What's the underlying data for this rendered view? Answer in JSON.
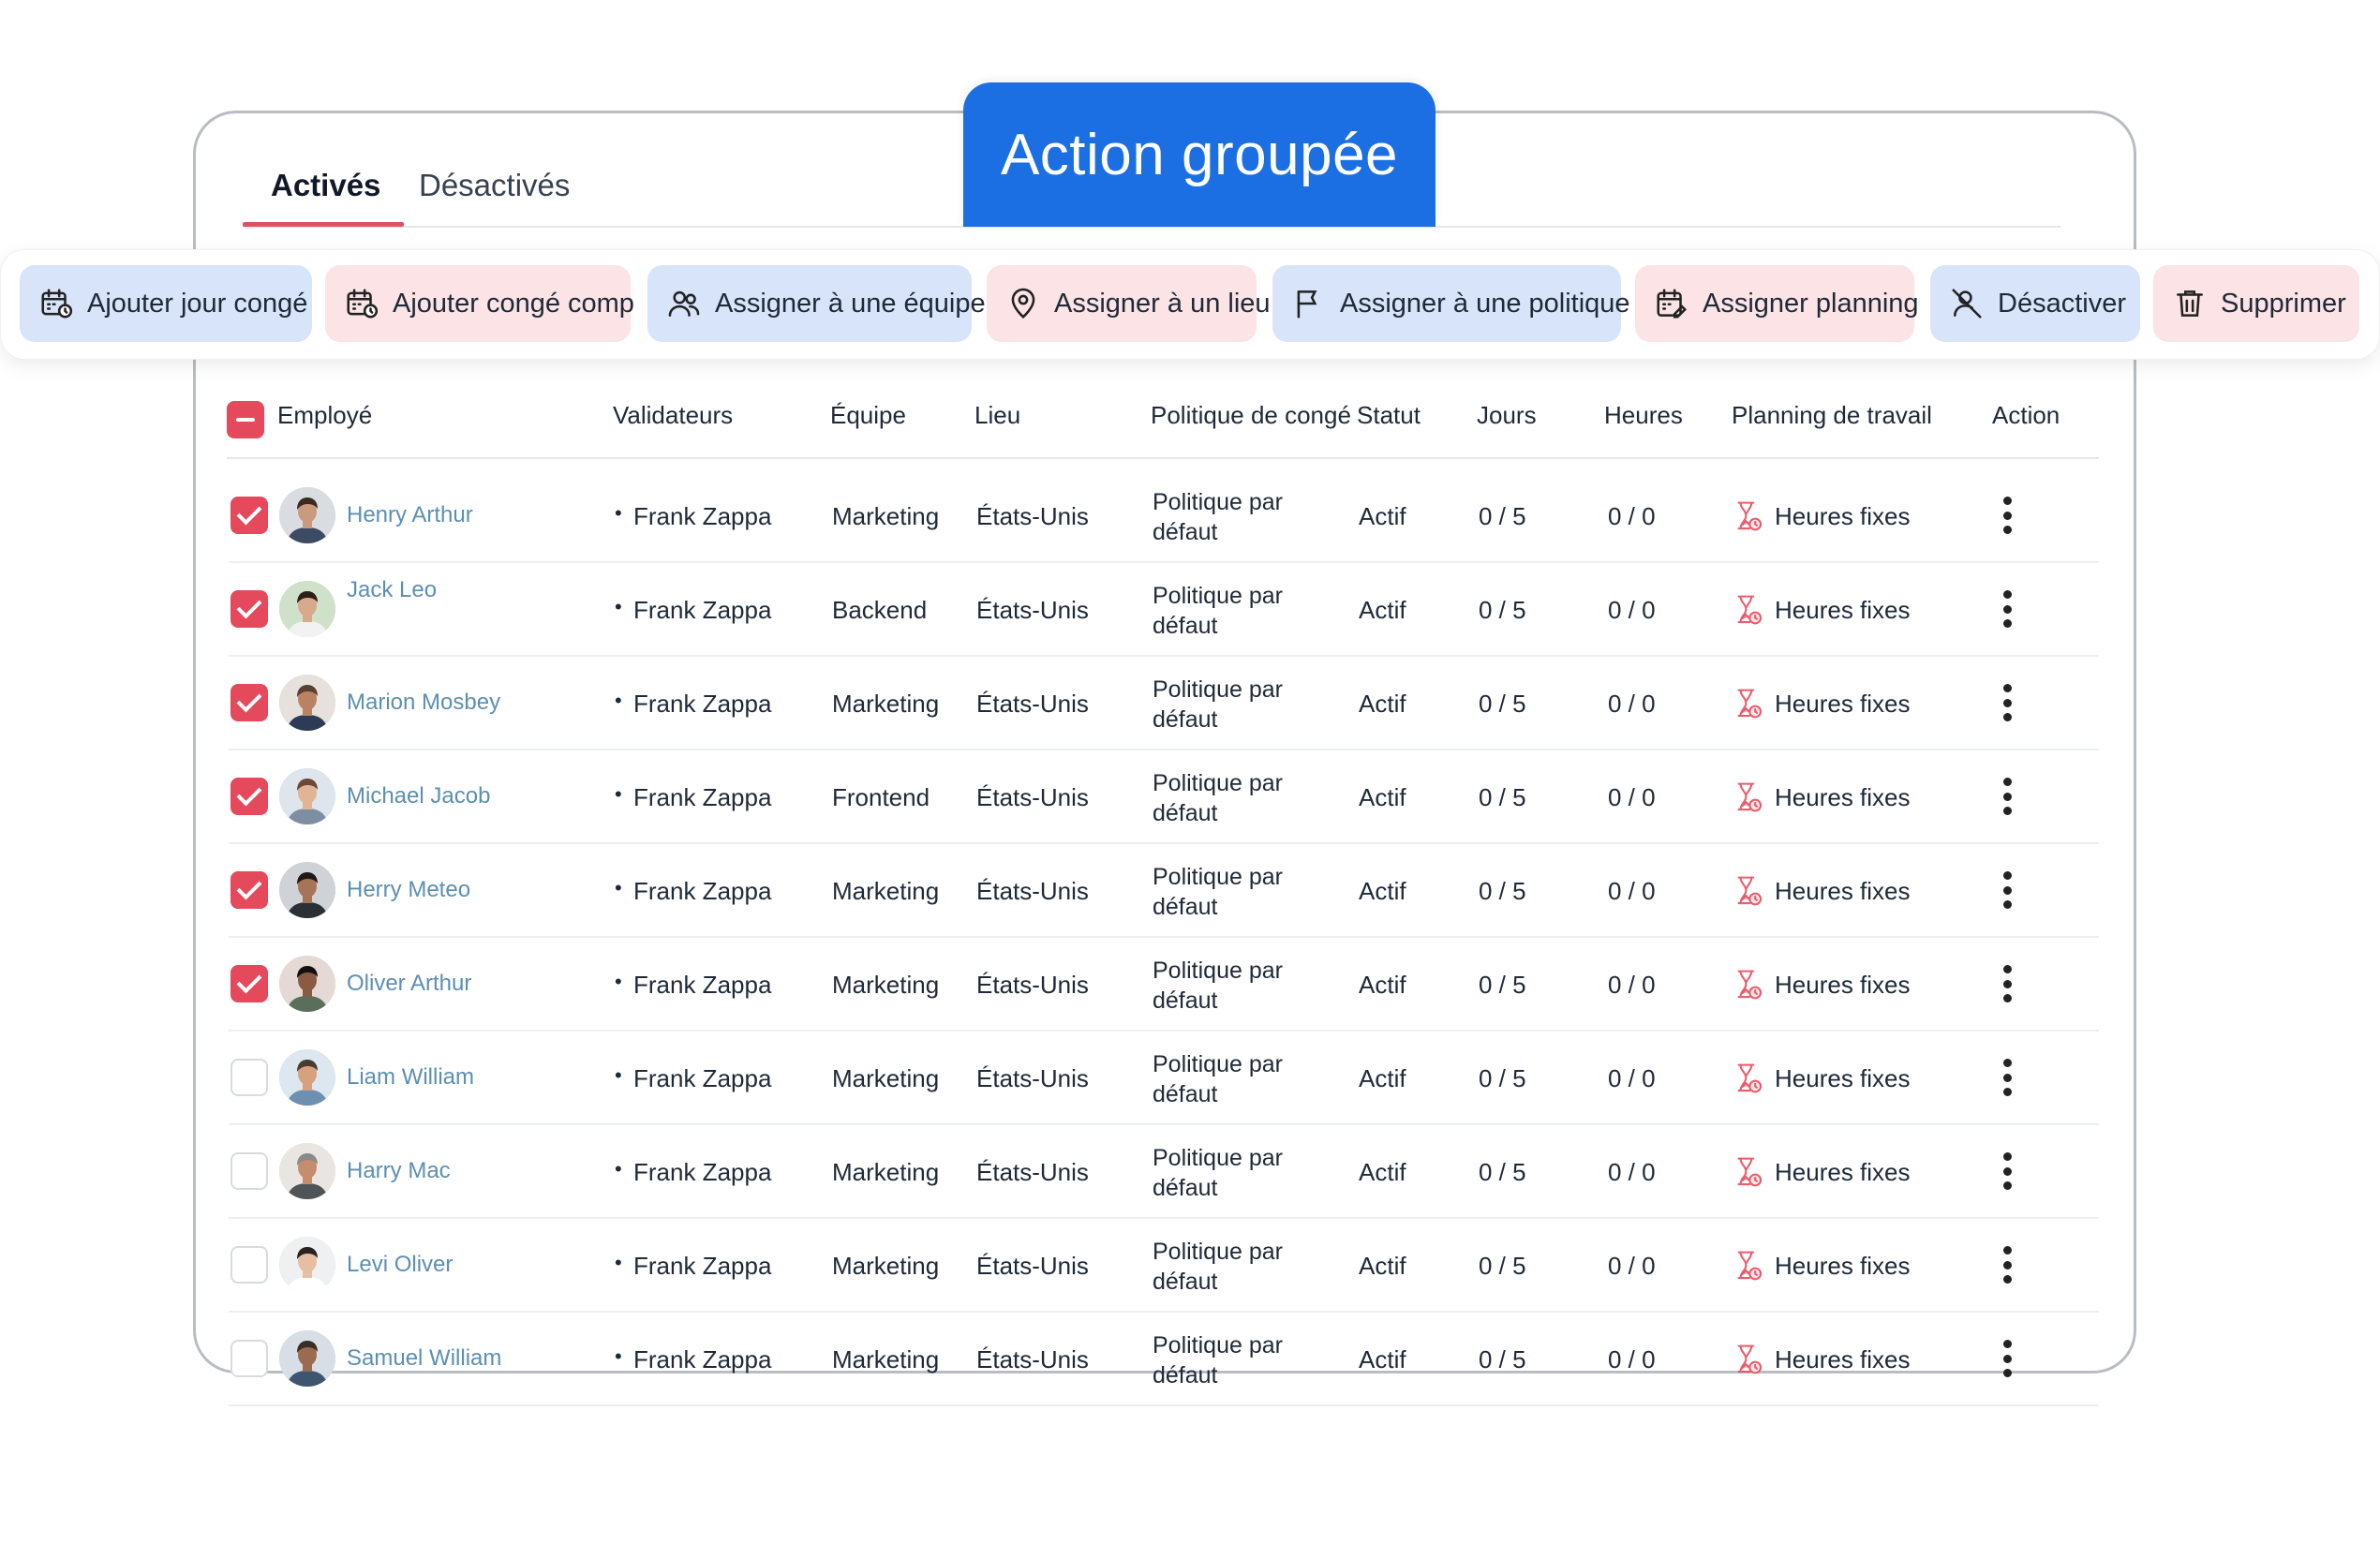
{
  "badge": {
    "title": "Action groupée",
    "color": "#1b6fe3"
  },
  "tabs": {
    "active": "Activés",
    "inactive": "Désactivés"
  },
  "toolbar": [
    {
      "label": "Ajouter jour congé",
      "icon": "calendar-clock-icon",
      "style": "blue"
    },
    {
      "label": "Ajouter congé comp",
      "icon": "calendar-clock-icon",
      "style": "pink"
    },
    {
      "label": "Assigner à une équipe",
      "icon": "users-icon",
      "style": "blue"
    },
    {
      "label": "Assigner à un lieu",
      "icon": "map-pin-icon",
      "style": "pink"
    },
    {
      "label": "Assigner à une politique",
      "icon": "flag-icon",
      "style": "blue"
    },
    {
      "label": "Assigner planning",
      "icon": "calendar-edit-icon",
      "style": "pink"
    },
    {
      "label": "Désactiver",
      "icon": "user-off-icon",
      "style": "blue"
    },
    {
      "label": "Supprimer",
      "icon": "trash-icon",
      "style": "pink"
    }
  ],
  "table": {
    "headers": {
      "employee": "Employé",
      "validators": "Validateurs",
      "team": "Équipe",
      "location": "Lieu",
      "policy": "Politique de congé",
      "status": "Statut",
      "days": "Jours",
      "hours": "Heures",
      "schedule": "Planning de travail",
      "action": "Action"
    },
    "rows": [
      {
        "name": "Henry Arthur",
        "checked": true,
        "validator": "Frank Zappa",
        "team": "Marketing",
        "location": "États-Unis",
        "policy_line1": "Politique par",
        "policy_line2": "défaut",
        "status": "Actif",
        "days": "0 / 5",
        "hours": "0 / 0",
        "schedule": "Heures fixes"
      },
      {
        "name": "Jack Leo",
        "checked": true,
        "validator": "Frank Zappa",
        "team": "Backend",
        "location": "États-Unis",
        "policy_line1": "Politique par",
        "policy_line2": "défaut",
        "status": "Actif",
        "days": "0 / 5",
        "hours": "0 / 0",
        "schedule": "Heures fixes"
      },
      {
        "name": "Marion Mosbey",
        "checked": true,
        "validator": "Frank Zappa",
        "team": "Marketing",
        "location": "États-Unis",
        "policy_line1": "Politique par",
        "policy_line2": "défaut",
        "status": "Actif",
        "days": "0 / 5",
        "hours": "0 / 0",
        "schedule": "Heures fixes"
      },
      {
        "name": "Michael Jacob",
        "checked": true,
        "validator": "Frank Zappa",
        "team": "Frontend",
        "location": "États-Unis",
        "policy_line1": "Politique par",
        "policy_line2": "défaut",
        "status": "Actif",
        "days": "0 / 5",
        "hours": "0 / 0",
        "schedule": "Heures fixes"
      },
      {
        "name": "Herry Meteo",
        "checked": true,
        "validator": "Frank Zappa",
        "team": "Marketing",
        "location": "États-Unis",
        "policy_line1": "Politique par",
        "policy_line2": "défaut",
        "status": "Actif",
        "days": "0 / 5",
        "hours": "0 / 0",
        "schedule": "Heures fixes"
      },
      {
        "name": "Oliver Arthur",
        "checked": true,
        "validator": "Frank Zappa",
        "team": "Marketing",
        "location": "États-Unis",
        "policy_line1": "Politique par",
        "policy_line2": "défaut",
        "status": "Actif",
        "days": "0 / 5",
        "hours": "0 / 0",
        "schedule": "Heures fixes"
      },
      {
        "name": "Liam William",
        "checked": false,
        "validator": "Frank Zappa",
        "team": "Marketing",
        "location": "États-Unis",
        "policy_line1": "Politique par",
        "policy_line2": "défaut",
        "status": "Actif",
        "days": "0 / 5",
        "hours": "0 / 0",
        "schedule": "Heures fixes"
      },
      {
        "name": "Harry Mac",
        "checked": false,
        "validator": "Frank Zappa",
        "team": "Marketing",
        "location": "États-Unis",
        "policy_line1": "Politique par",
        "policy_line2": "défaut",
        "status": "Actif",
        "days": "0 / 5",
        "hours": "0 / 0",
        "schedule": "Heures fixes"
      },
      {
        "name": "Levi Oliver",
        "checked": false,
        "validator": "Frank Zappa",
        "team": "Marketing",
        "location": "États-Unis",
        "policy_line1": "Politique par",
        "policy_line2": "défaut",
        "status": "Actif",
        "days": "0 / 5",
        "hours": "0 / 0",
        "schedule": "Heures fixes"
      },
      {
        "name": "Samuel William",
        "checked": false,
        "validator": "Frank Zappa",
        "team": "Marketing",
        "location": "États-Unis",
        "policy_line1": "Politique par",
        "policy_line2": "défaut",
        "status": "Actif",
        "days": "0 / 5",
        "hours": "0 / 0",
        "schedule": "Heures fixes"
      }
    ]
  }
}
